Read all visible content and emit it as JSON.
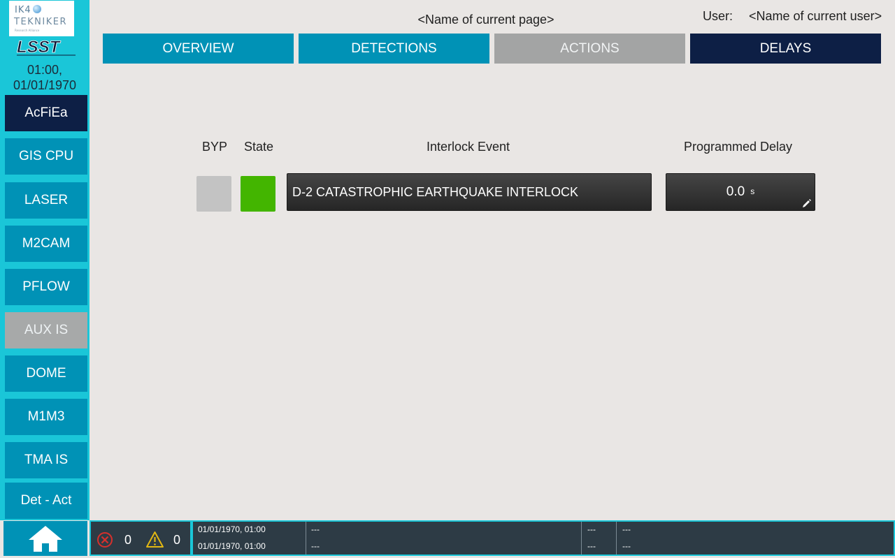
{
  "sidebar": {
    "logo_ik4_line1": "IK4",
    "logo_ik4_line2": "TEKNIKER",
    "logo_ik4_line3": "Research Alliance",
    "logo_lsst": "LSST",
    "clock_time": "01:00,",
    "clock_date": "01/01/1970",
    "items": [
      {
        "label": "AcFiEa",
        "state": "active"
      },
      {
        "label": "GIS CPU",
        "state": "normal"
      },
      {
        "label": "LASER",
        "state": "normal"
      },
      {
        "label": "M2CAM",
        "state": "normal"
      },
      {
        "label": "PFLOW",
        "state": "normal"
      },
      {
        "label": "AUX IS",
        "state": "disabled"
      },
      {
        "label": "DOME",
        "state": "normal"
      },
      {
        "label": "M1M3",
        "state": "normal"
      },
      {
        "label": "TMA IS",
        "state": "normal"
      },
      {
        "label": "Det - Act",
        "state": "normal"
      }
    ],
    "home_icon": "home-icon"
  },
  "header": {
    "page_title": "<Name of current page>",
    "user_label": "User:",
    "user_name": "<Name of current user>"
  },
  "tabs": [
    {
      "label": "OVERVIEW",
      "state": "normal"
    },
    {
      "label": "DETECTIONS",
      "state": "normal"
    },
    {
      "label": "ACTIONS",
      "state": "disabled"
    },
    {
      "label": "DELAYS",
      "state": "active"
    }
  ],
  "table": {
    "headers": {
      "byp": "BYP",
      "state": "State",
      "event": "Interlock Event",
      "delay": "Programmed Delay"
    },
    "rows": [
      {
        "byp_color": "#c3c3c3",
        "state_color": "#43b500",
        "event": "D-2 CATASTROPHIC EARTHQUAKE INTERLOCK",
        "delay_value": "0.0",
        "delay_unit": "s",
        "edit_icon": "pencil-icon"
      }
    ]
  },
  "footer": {
    "error_icon": "error-icon",
    "error_count": "0",
    "warning_icon": "warning-icon",
    "warning_count": "0",
    "log": [
      {
        "timestamp": "01/01/1970, 01:00",
        "message": "---",
        "code": "---",
        "detail": "---"
      },
      {
        "timestamp": "01/01/1970, 01:00",
        "message": "---",
        "code": "---",
        "detail": "---"
      }
    ]
  },
  "colors": {
    "sidebar": "#1ac6d8",
    "button": "#0092b6",
    "active": "#0d1f45",
    "disabled": "#a3a4a4",
    "ok_green": "#43b500",
    "footer_bg": "#2d3b45",
    "background": "#e9e6e4"
  }
}
